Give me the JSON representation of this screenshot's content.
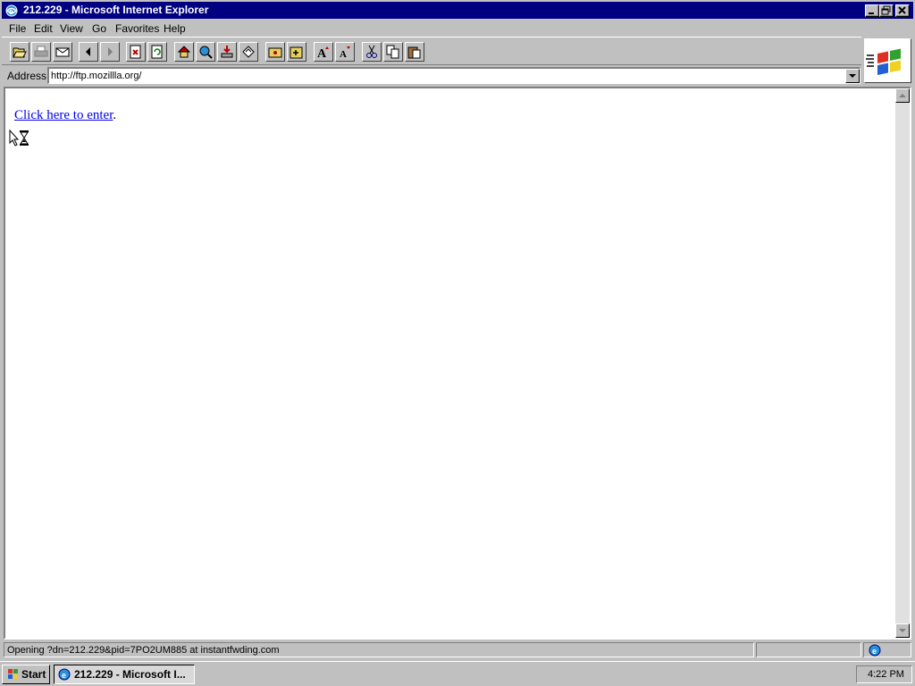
{
  "window": {
    "title": "212.229 - Microsoft Internet Explorer"
  },
  "menu": {
    "items": [
      {
        "label": "File"
      },
      {
        "label": "Edit"
      },
      {
        "label": "View"
      },
      {
        "label": "Go"
      },
      {
        "label": "Favorites"
      },
      {
        "label": "Help"
      }
    ]
  },
  "toolbar": {
    "buttons": [
      {
        "icon": "open-folder-icon"
      },
      {
        "icon": "print-icon"
      },
      {
        "icon": "mail-icon"
      },
      {
        "icon": "back-arrow-icon"
      },
      {
        "icon": "forward-arrow-icon"
      },
      {
        "icon": "stop-icon"
      },
      {
        "icon": "refresh-icon"
      },
      {
        "icon": "home-icon"
      },
      {
        "icon": "search-icon"
      },
      {
        "icon": "download-icon"
      },
      {
        "icon": "history-icon"
      },
      {
        "icon": "favorites-folder-icon"
      },
      {
        "icon": "add-favorite-icon"
      },
      {
        "icon": "larger-font-icon"
      },
      {
        "icon": "smaller-font-icon"
      },
      {
        "icon": "cut-icon"
      },
      {
        "icon": "copy-icon"
      },
      {
        "icon": "paste-icon"
      }
    ]
  },
  "address": {
    "label": "Address:",
    "value": "http://ftp.mozillla.org/"
  },
  "content": {
    "link_text": "Click here to enter",
    "trailing": "."
  },
  "status": {
    "text": "Opening ?dn=212.229&pid=7PO2UM885 at instantfwding.com"
  },
  "taskbar": {
    "start_label": "Start",
    "task_label": "212.229 - Microsoft I...",
    "clock": "4:22 PM"
  },
  "colors": {
    "titlebar": "#000080",
    "link": "#0000ee",
    "face": "#c0c0c0"
  }
}
